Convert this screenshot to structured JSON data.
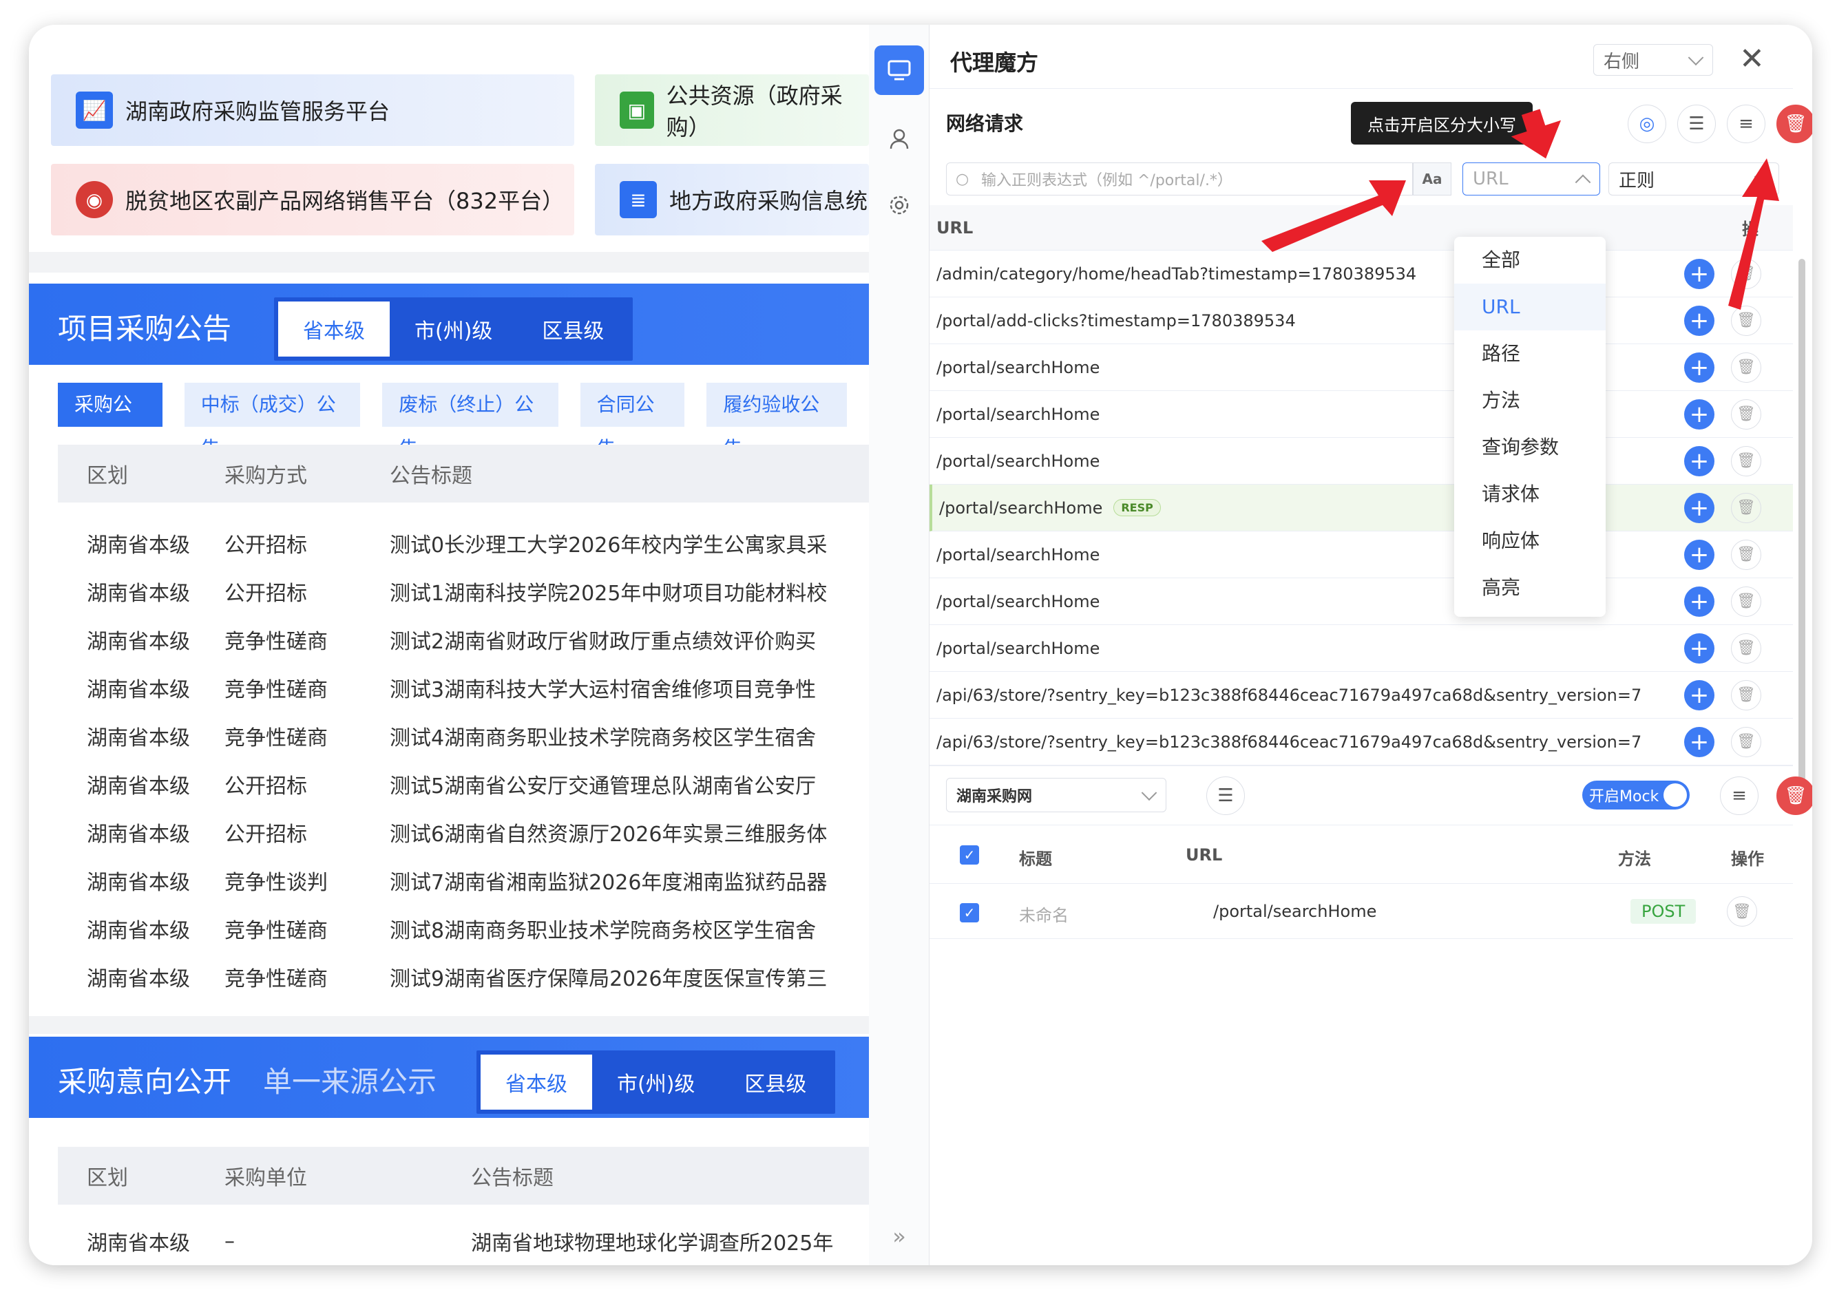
{
  "left": {
    "cards": [
      "湖南政府采购监管服务平台",
      "公共资源（政府采购）",
      "脱贫地区农副产品网络销售平台（832平台）",
      "地方政府采购信息统"
    ],
    "section1": {
      "title": "项目采购公告",
      "tabs": [
        "省本级",
        "市(州)级",
        "区县级"
      ],
      "subtabs": [
        "采购公告",
        "中标（成交）公告",
        "废标（终止）公告",
        "合同公告",
        "履约验收公告"
      ],
      "headers": [
        "区划",
        "采购方式",
        "公告标题"
      ],
      "rows": [
        [
          "湖南省本级",
          "公开招标",
          "测试0长沙理工大学2026年校内学生公寓家具采"
        ],
        [
          "湖南省本级",
          "公开招标",
          "测试1湖南科技学院2025年中财项目功能材料校"
        ],
        [
          "湖南省本级",
          "竞争性磋商",
          "测试2湖南省财政厅省财政厅重点绩效评价购买"
        ],
        [
          "湖南省本级",
          "竞争性磋商",
          "测试3湖南科技大学大运村宿舍维修项目竞争性"
        ],
        [
          "湖南省本级",
          "竞争性磋商",
          "测试4湖南商务职业技术学院商务校区学生宿舍"
        ],
        [
          "湖南省本级",
          "公开招标",
          "测试5湖南省公安厅交通管理总队湖南省公安厅"
        ],
        [
          "湖南省本级",
          "公开招标",
          "测试6湖南省自然资源厅2026年实景三维服务体"
        ],
        [
          "湖南省本级",
          "竞争性谈判",
          "测试7湖南省湘南监狱2026年度湘南监狱药品器"
        ],
        [
          "湖南省本级",
          "竞争性磋商",
          "测试8湖南商务职业技术学院商务校区学生宿舍"
        ],
        [
          "湖南省本级",
          "竞争性磋商",
          "测试9湖南省医疗保障局2026年度医保宣传第三"
        ]
      ]
    },
    "section2": {
      "title": "采购意向公开",
      "title2": "单一来源公示",
      "tabs": [
        "省本级",
        "市(州)级",
        "区县级"
      ],
      "headers": [
        "区划",
        "采购单位",
        "公告标题"
      ],
      "rows": [
        [
          "湖南省本级",
          "–",
          "湖南省地球物理地球化学调查所2025年"
        ]
      ]
    }
  },
  "panel": {
    "title": "代理魔方",
    "position_select": "右侧",
    "section_title": "网络请求",
    "tooltip": "点击开启区分大小写",
    "search_placeholder": "输入正则表达式（例如 ^/portal/.*）",
    "case_btn": "Aa",
    "field_select": "URL",
    "mode_select": "正则",
    "col_url": "URL",
    "col_op": "操",
    "urls": [
      "/admin/category/home/headTab?timestamp=1780389534",
      "/portal/add-clicks?timestamp=1780389534",
      "/portal/searchHome",
      "/portal/searchHome",
      "/portal/searchHome",
      "/portal/searchHome",
      "/portal/searchHome",
      "/portal/searchHome",
      "/portal/searchHome",
      "/api/63/store/?sentry_key=b123c388f68446ceac71679a497ca68d&sentry_version=7",
      "/api/63/store/?sentry_key=b123c388f68446ceac71679a497ca68d&sentry_version=7"
    ],
    "resp_badge": "RESP",
    "dropdown": [
      "全部",
      "URL",
      "路径",
      "方法",
      "查询参数",
      "请求体",
      "响应体",
      "高亮"
    ],
    "mock": {
      "site_select": "湖南采购网",
      "toggle_label": "开启Mock",
      "headers": [
        "标题",
        "URL",
        "方法",
        "操作"
      ],
      "row": {
        "title": "未命名",
        "url": "/portal/searchHome",
        "method": "POST"
      }
    }
  },
  "colors": {
    "brand": "#3d7bf4",
    "danger": "#e64c4c",
    "arrow": "#e8202a"
  }
}
